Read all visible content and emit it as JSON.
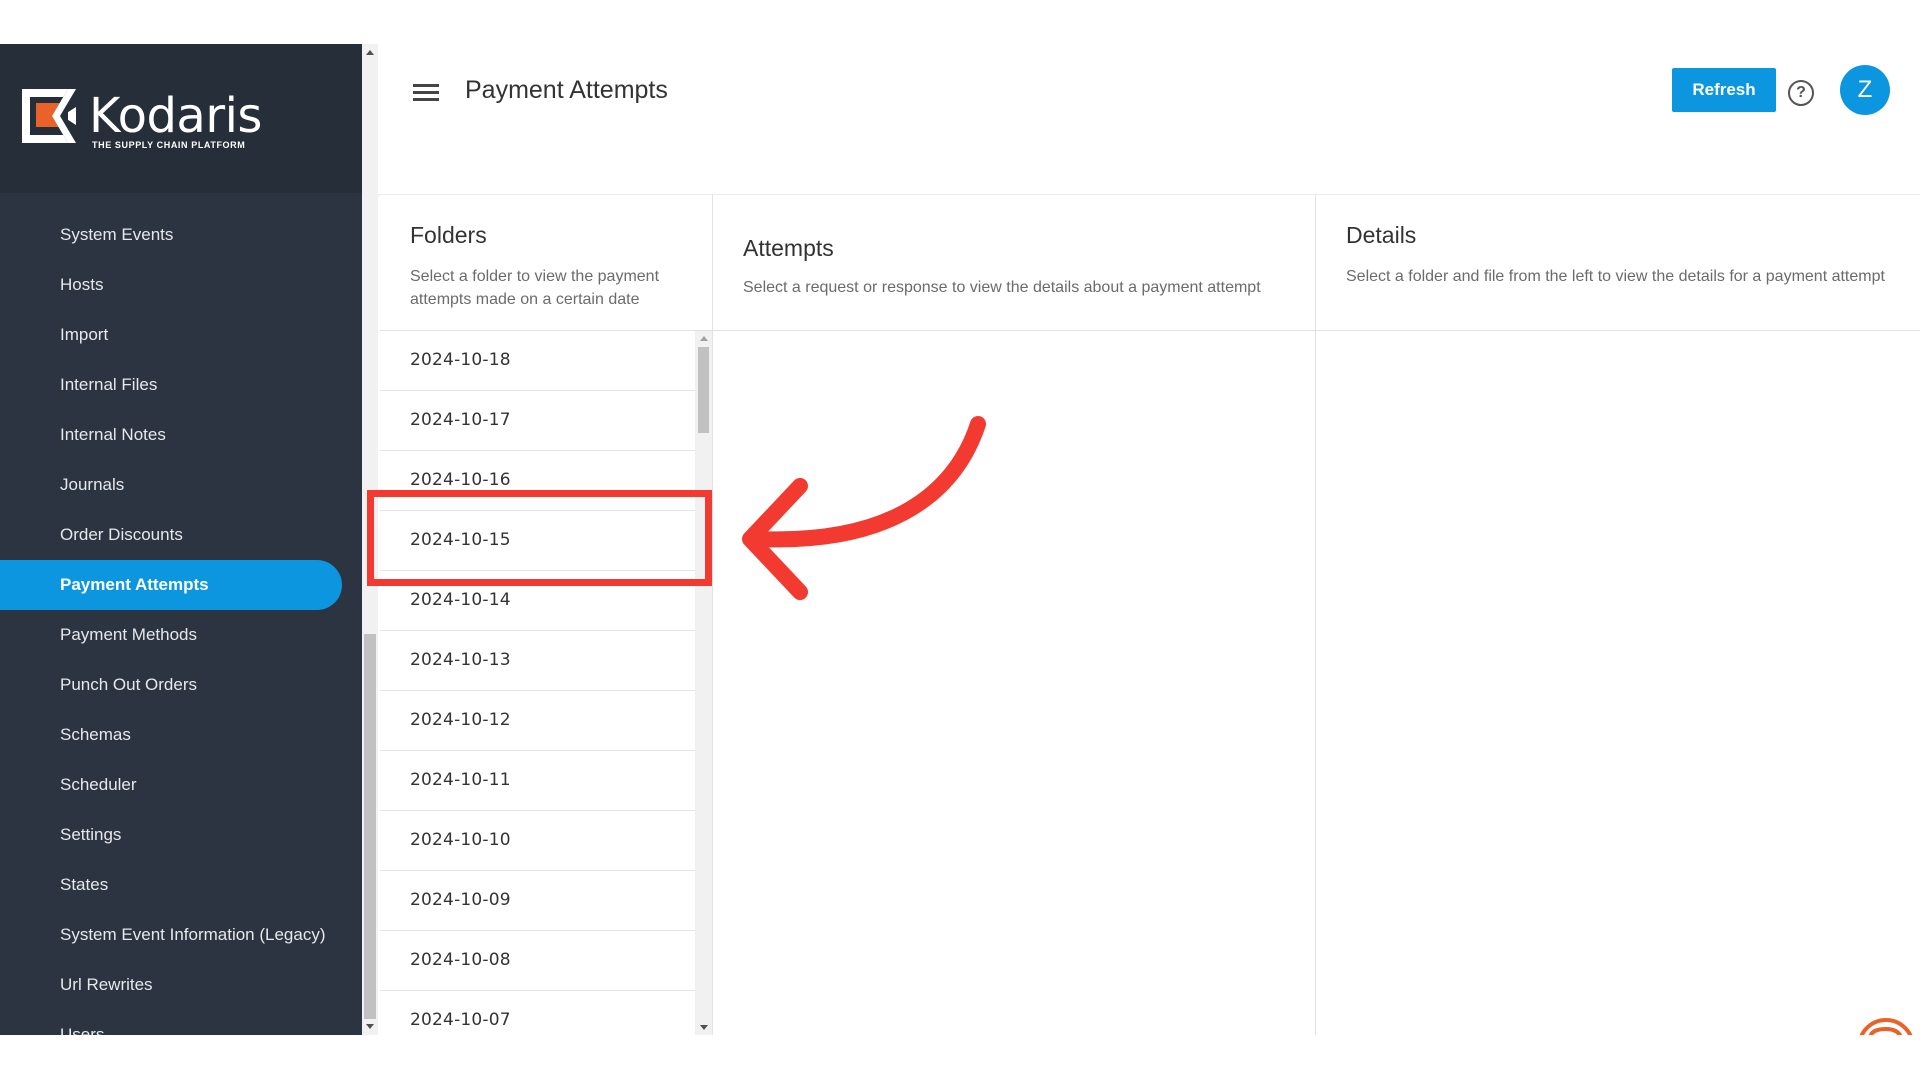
{
  "brand": {
    "name": "Kodaris",
    "tagline": "THE SUPPLY CHAIN PLATFORM",
    "accent": "#0d96e0",
    "sidebar_bg": "#2b3440"
  },
  "sidebar": {
    "items": [
      {
        "label": "System Events"
      },
      {
        "label": "Hosts"
      },
      {
        "label": "Import"
      },
      {
        "label": "Internal Files"
      },
      {
        "label": "Internal Notes"
      },
      {
        "label": "Journals"
      },
      {
        "label": "Order Discounts"
      },
      {
        "label": "Payment Attempts",
        "active": true
      },
      {
        "label": "Payment Methods"
      },
      {
        "label": "Punch Out Orders"
      },
      {
        "label": "Schemas"
      },
      {
        "label": "Scheduler"
      },
      {
        "label": "Settings"
      },
      {
        "label": "States"
      },
      {
        "label": "System Event Information (Legacy)"
      },
      {
        "label": "Url Rewrites"
      },
      {
        "label": "Users"
      }
    ]
  },
  "header": {
    "title": "Payment Attempts",
    "refresh_label": "Refresh",
    "help_glyph": "?",
    "avatar_initial": "Z"
  },
  "panels": {
    "folders": {
      "title": "Folders",
      "description": "Select a folder to view the payment attempts made on a certain date",
      "items": [
        "2024-10-18",
        "2024-10-17",
        "2024-10-16",
        "2024-10-15",
        "2024-10-14",
        "2024-10-13",
        "2024-10-12",
        "2024-10-11",
        "2024-10-10",
        "2024-10-09",
        "2024-10-08",
        "2024-10-07"
      ],
      "highlighted": "2024-10-15"
    },
    "attempts": {
      "title": "Attempts",
      "description": "Select a request or response to view the details about a payment attempt"
    },
    "details": {
      "title": "Details",
      "description": "Select a folder and file from the left to view the details for a payment attempt"
    }
  },
  "annotation": {
    "color": "#f23a30"
  },
  "icons": {
    "menu": "hamburger-menu-icon",
    "help": "help-circle-icon",
    "chat": "chat-bubble-icon"
  }
}
